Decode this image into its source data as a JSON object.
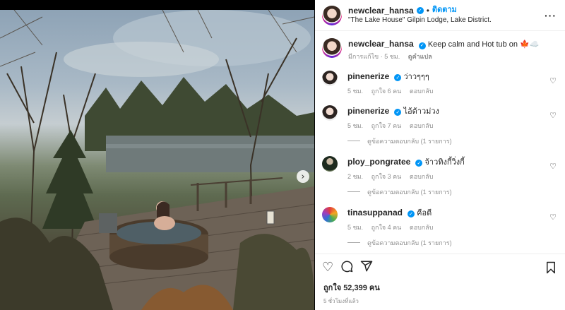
{
  "post": {
    "author": "newclear_hansa",
    "follow_label": "ติดตาม",
    "dot": "•",
    "location": "\"The Lake House\" Gilpin Lodge, Lake District.",
    "more_icon": "more-horizontal-icon",
    "caption": "Keep calm and Hot tub on 🍁☁️",
    "caption_time": "มีการแก้ไข · 5 ชม.",
    "caption_translate": "ดูคำแปล",
    "likes": "ถูกใจ 52,399 คน",
    "time_ago": "5 ชั่วโมงที่แล้ว"
  },
  "comments": [
    {
      "user": "pinenerize",
      "text": "ว่าวๆๆๆ",
      "time": "5 ชม.",
      "likes": "ถูกใจ 6 คน",
      "reply": "ตอบกลับ",
      "view_replies": ""
    },
    {
      "user": "pinenerize",
      "text": "ไอ้ต้าวม่วง",
      "time": "5 ชม.",
      "likes": "ถูกใจ 7 คน",
      "reply": "ตอบกลับ",
      "view_replies": "ดูข้อความตอบกลับ (1 รายการ)"
    },
    {
      "user": "ploy_pongratee",
      "text": "จ้าวทิงกี้วิ่งกี้",
      "time": "2 ชม.",
      "likes": "ถูกใจ 3 คน",
      "reply": "ตอบกลับ",
      "view_replies": "ดูข้อความตอบกลับ (1 รายการ)"
    },
    {
      "user": "tinasuppanad",
      "text": "คือดี",
      "time": "5 ชม.",
      "likes": "ถูกใจ 4 คน",
      "reply": "ตอบกลับ",
      "view_replies": "ดูข้อความตอบกลับ (1 รายการ)"
    }
  ],
  "icons": {
    "verified": "verified-badge-icon",
    "heart_small": "heart-outline-icon",
    "like": "heart-icon",
    "comment": "comment-icon",
    "share": "send-icon",
    "save": "bookmark-icon",
    "next": "chevron-right-icon"
  },
  "colors": {
    "accent": "#0095f6",
    "muted": "#8e8e8e",
    "text": "#262626"
  }
}
